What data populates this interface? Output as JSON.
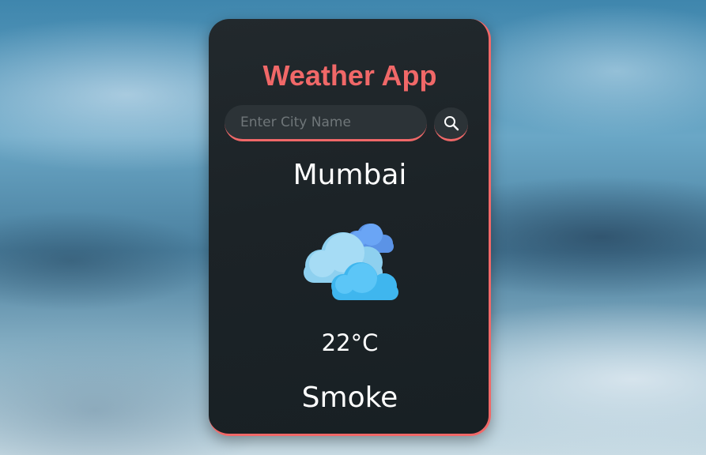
{
  "app": {
    "title": "Weather App"
  },
  "search": {
    "placeholder": "Enter City Name",
    "value": "",
    "button_icon": "search-icon"
  },
  "weather": {
    "city": "Mumbai",
    "icon": "clouds-icon",
    "temperature": "22°C",
    "condition": "Smoke"
  },
  "colors": {
    "accent": "#f06868",
    "card_background": "#1c2327",
    "text": "#ffffff",
    "input_background": "#2c3337"
  }
}
